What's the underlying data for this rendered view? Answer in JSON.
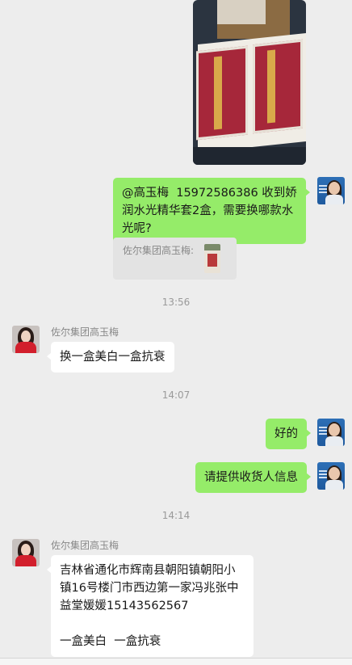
{
  "messages": {
    "m1_text": "@高玉梅  15972586386 收到娇润水光精华套2盒，需要换哪款水光呢?",
    "quote_sender": "佐尔集团高玉梅:",
    "time1": "13:56",
    "m2_sender": "佐尔集团高玉梅",
    "m2_text": "换一盒美白一盒抗衰",
    "time2": "14:07",
    "m3_text": "好的",
    "m4_text": "请提供收货人信息",
    "time3": "14:14",
    "m5_sender": "佐尔集团高玉梅",
    "m5_text": "吉林省通化市辉南县朝阳镇朝阳小镇16号楼门市西边第一家冯兆张中益堂媛媛15143562567\n\n一盒美白  一盒抗衰"
  },
  "colors": {
    "background": "#ededed",
    "sent_bubble": "#95ec69",
    "received_bubble": "#ffffff"
  },
  "icons": {
    "my_avatar": "avatar-me",
    "contact_avatar": "avatar-her"
  }
}
